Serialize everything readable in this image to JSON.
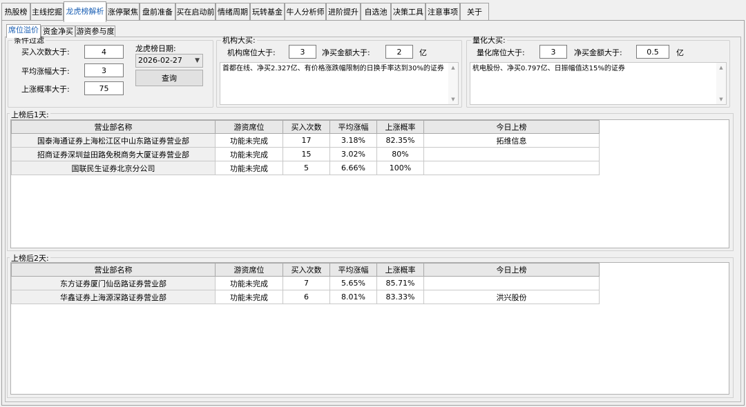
{
  "tabs": [
    {
      "label": "热股榜"
    },
    {
      "label": "主线挖掘"
    },
    {
      "label": "龙虎榜解析"
    },
    {
      "label": "涨停聚焦"
    },
    {
      "label": "盘前准备"
    },
    {
      "label": "买在启动前"
    },
    {
      "label": "情绪周期"
    },
    {
      "label": "玩转基金"
    },
    {
      "label": "牛人分析师"
    },
    {
      "label": "进阶提升"
    },
    {
      "label": "自选池"
    },
    {
      "label": "决策工具"
    },
    {
      "label": "注意事项"
    },
    {
      "label": "关于"
    }
  ],
  "subtabs": [
    {
      "label": "席位溢价"
    },
    {
      "label": "资金净买"
    },
    {
      "label": "游资参与度"
    }
  ],
  "filter": {
    "title": "条件过滤",
    "buy_count_label": "买入次数大于:",
    "buy_count_value": "4",
    "avg_gain_label": "平均涨幅大于:",
    "avg_gain_value": "3",
    "up_prob_label": "上涨概率大于:",
    "up_prob_value": "75",
    "date_label": "龙虎榜日期:",
    "date_value": "2026-02-27",
    "query_button": "查询"
  },
  "institution": {
    "title": "机构大买:",
    "seats_label": "机构席位大于:",
    "seats_value": "3",
    "amount_label": "净买金额大于:",
    "amount_value": "2",
    "unit": "亿",
    "memo": "首都在线、净买2.327亿、有价格涨跌幅限制的日换手率达到30%的证券"
  },
  "quant": {
    "title": "量化大买:",
    "seats_label": "量化席位大于:",
    "seats_value": "3",
    "amount_label": "净买金额大于:",
    "amount_value": "0.5",
    "unit": "亿",
    "memo": "杭电股份、净买0.797亿、日振幅值达15%的证券"
  },
  "columns": [
    "营业部名称",
    "游资席位",
    "买入次数",
    "平均涨幅",
    "上涨概率",
    "今日上榜"
  ],
  "day1": {
    "title": "上榜后1天:",
    "rows": [
      [
        "国泰海通证券上海松江区中山东路证券营业部",
        "功能未完成",
        "17",
        "3.18%",
        "82.35%",
        "拓维信息"
      ],
      [
        "招商证券深圳益田路免税商务大厦证券营业部",
        "功能未完成",
        "15",
        "3.02%",
        "80%",
        ""
      ],
      [
        "国联民生证券北京分公司",
        "功能未完成",
        "5",
        "6.66%",
        "100%",
        ""
      ]
    ]
  },
  "day2": {
    "title": "上榜后2天:",
    "rows": [
      [
        "东方证券厦门仙岳路证券营业部",
        "功能未完成",
        "7",
        "5.65%",
        "85.71%",
        ""
      ],
      [
        "华鑫证券上海源深路证券营业部",
        "功能未完成",
        "6",
        "8.01%",
        "83.33%",
        "洪兴股份"
      ]
    ]
  }
}
